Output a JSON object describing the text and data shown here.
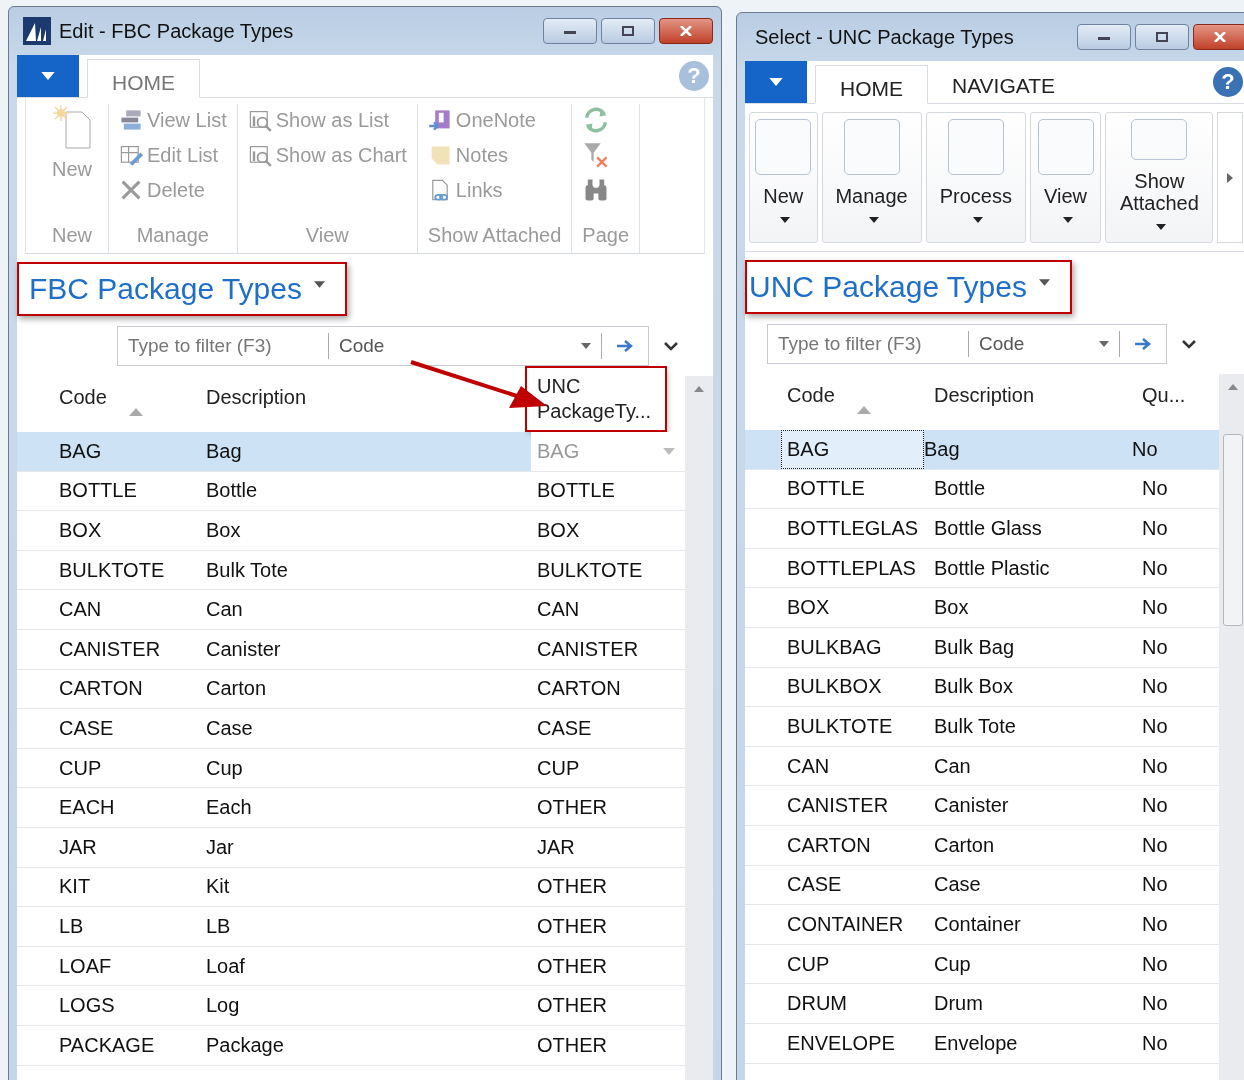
{
  "windows": [
    {
      "title": "Edit - FBC Package Types",
      "active": false,
      "help": "?",
      "tabs": [
        {
          "label": "HOME",
          "selected": true
        }
      ],
      "ribbon": {
        "kind": "groups",
        "disabled": true,
        "groups": [
          {
            "label": "New",
            "items": [
              {
                "kind": "large",
                "label": "New"
              }
            ]
          },
          {
            "label": "Manage",
            "items": [
              {
                "kind": "small",
                "label": "View List"
              },
              {
                "kind": "small",
                "label": "Edit List"
              },
              {
                "kind": "small",
                "label": "Delete"
              }
            ]
          },
          {
            "label": "View",
            "items": [
              {
                "kind": "small",
                "label": "Show as List"
              },
              {
                "kind": "small",
                "label": "Show as Chart"
              }
            ]
          },
          {
            "label": "Show Attached",
            "items": [
              {
                "kind": "small",
                "label": "OneNote"
              },
              {
                "kind": "small",
                "label": "Notes"
              },
              {
                "kind": "small",
                "label": "Links"
              }
            ]
          },
          {
            "label": "Page",
            "items": [
              {
                "kind": "icon"
              },
              {
                "kind": "icon"
              },
              {
                "kind": "icon"
              }
            ]
          }
        ]
      },
      "page_title": {
        "text": "FBC Package Types",
        "highlighted": true
      },
      "filter": {
        "placeholder": "Type to filter (F3)",
        "field": "Code"
      },
      "columns": [
        {
          "label": "Code",
          "sorted": true,
          "highlighted": false
        },
        {
          "label": "Description",
          "sorted": false,
          "highlighted": false
        },
        {
          "label": "UNC PackageTy...",
          "sorted": false,
          "highlighted": true
        }
      ],
      "rows": [
        {
          "cells": [
            "BAG",
            "Bag",
            "BAG"
          ],
          "selected": true,
          "focused": false
        },
        {
          "cells": [
            "BOTTLE",
            "Bottle",
            "BOTTLE"
          ],
          "selected": false,
          "focused": false
        },
        {
          "cells": [
            "BOX",
            "Box",
            "BOX"
          ],
          "selected": false,
          "focused": false
        },
        {
          "cells": [
            "BULKTOTE",
            "Bulk Tote",
            "BULKTOTE"
          ],
          "selected": false,
          "focused": false
        },
        {
          "cells": [
            "CAN",
            "Can",
            "CAN"
          ],
          "selected": false,
          "focused": false
        },
        {
          "cells": [
            "CANISTER",
            "Canister",
            "CANISTER"
          ],
          "selected": false,
          "focused": false
        },
        {
          "cells": [
            "CARTON",
            "Carton",
            "CARTON"
          ],
          "selected": false,
          "focused": false
        },
        {
          "cells": [
            "CASE",
            "Case",
            "CASE"
          ],
          "selected": false,
          "focused": false
        },
        {
          "cells": [
            "CUP",
            "Cup",
            "CUP"
          ],
          "selected": false,
          "focused": false
        },
        {
          "cells": [
            "EACH",
            "Each",
            "OTHER"
          ],
          "selected": false,
          "focused": false
        },
        {
          "cells": [
            "JAR",
            "Jar",
            "JAR"
          ],
          "selected": false,
          "focused": false
        },
        {
          "cells": [
            "KIT",
            "Kit",
            "OTHER"
          ],
          "selected": false,
          "focused": false
        },
        {
          "cells": [
            "LB",
            "LB",
            "OTHER"
          ],
          "selected": false,
          "focused": false
        },
        {
          "cells": [
            "LOAF",
            "Loaf",
            "OTHER"
          ],
          "selected": false,
          "focused": false
        },
        {
          "cells": [
            "LOGS",
            "Log",
            "OTHER"
          ],
          "selected": false,
          "focused": false
        },
        {
          "cells": [
            "PACKAGE",
            "Package",
            "OTHER"
          ],
          "selected": false,
          "focused": false
        }
      ],
      "annotation_arrow": true
    },
    {
      "title": "Select - UNC Package Types",
      "active": true,
      "help": "?",
      "tabs": [
        {
          "label": "HOME",
          "selected": true
        },
        {
          "label": "NAVIGATE",
          "selected": false
        }
      ],
      "ribbon": {
        "kind": "buttons",
        "disabled": false,
        "groups": [
          {
            "label": "New"
          },
          {
            "label": "Manage"
          },
          {
            "label": "Process"
          },
          {
            "label": "View"
          },
          {
            "label": "Show Attached"
          }
        ]
      },
      "page_title": {
        "text": "UNC Package Types",
        "highlighted": true
      },
      "filter": {
        "placeholder": "Type to filter (F3)",
        "field": "Code"
      },
      "columns": [
        {
          "label": "Code",
          "sorted": true,
          "highlighted": false
        },
        {
          "label": "Description",
          "sorted": false,
          "highlighted": false
        },
        {
          "label": "Qu...",
          "sorted": false,
          "highlighted": false
        }
      ],
      "rows": [
        {
          "cells": [
            "BAG",
            "Bag",
            "No"
          ],
          "selected": true,
          "focused": true
        },
        {
          "cells": [
            "BOTTLE",
            "Bottle",
            "No"
          ],
          "selected": false,
          "focused": false
        },
        {
          "cells": [
            "BOTTLEGLAS",
            "Bottle Glass",
            "No"
          ],
          "selected": false,
          "focused": false
        },
        {
          "cells": [
            "BOTTLEPLAS",
            "Bottle Plastic",
            "No"
          ],
          "selected": false,
          "focused": false
        },
        {
          "cells": [
            "BOX",
            "Box",
            "No"
          ],
          "selected": false,
          "focused": false
        },
        {
          "cells": [
            "BULKBAG",
            "Bulk Bag",
            "No"
          ],
          "selected": false,
          "focused": false
        },
        {
          "cells": [
            "BULKBOX",
            "Bulk Box",
            "No"
          ],
          "selected": false,
          "focused": false
        },
        {
          "cells": [
            "BULKTOTE",
            "Bulk Tote",
            "No"
          ],
          "selected": false,
          "focused": false
        },
        {
          "cells": [
            "CAN",
            "Can",
            "No"
          ],
          "selected": false,
          "focused": false
        },
        {
          "cells": [
            "CANISTER",
            "Canister",
            "No"
          ],
          "selected": false,
          "focused": false
        },
        {
          "cells": [
            "CARTON",
            "Carton",
            "No"
          ],
          "selected": false,
          "focused": false
        },
        {
          "cells": [
            "CASE",
            "Case",
            "No"
          ],
          "selected": false,
          "focused": false
        },
        {
          "cells": [
            "CONTAINER",
            "Container",
            "No"
          ],
          "selected": false,
          "focused": false
        },
        {
          "cells": [
            "CUP",
            "Cup",
            "No"
          ],
          "selected": false,
          "focused": false
        },
        {
          "cells": [
            "DRUM",
            "Drum",
            "No"
          ],
          "selected": false,
          "focused": false
        },
        {
          "cells": [
            "ENVELOPE",
            "Envelope",
            "No"
          ],
          "selected": false,
          "focused": false
        }
      ],
      "annotation_arrow": false
    }
  ]
}
